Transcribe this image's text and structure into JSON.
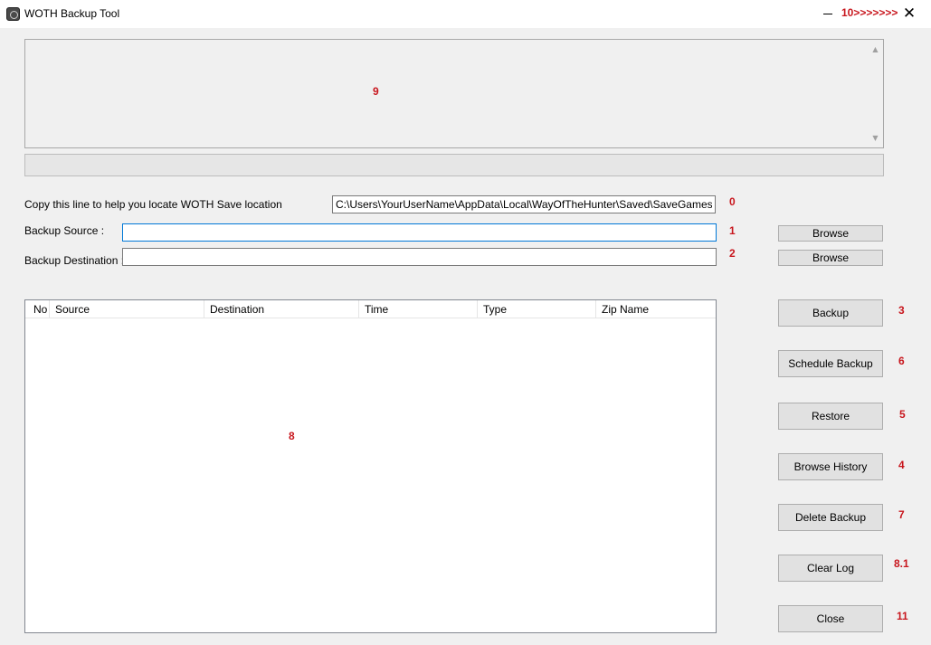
{
  "window": {
    "title": "WOTH Backup Tool",
    "icon": "app-icon",
    "close_glyph": "✕"
  },
  "colors": {
    "callout": "#c8161d",
    "background": "#f0f0f0",
    "focus_border": "#0078d7"
  },
  "callouts": {
    "c0": "0",
    "c1": "1",
    "c2": "2",
    "c3": "3",
    "c4": "4",
    "c5": "5",
    "c6": "6",
    "c7": "7",
    "c8": "8",
    "c8_1": "8.1",
    "c9": "9",
    "c10": "10>>>>>>>",
    "c11": "11"
  },
  "save_location": {
    "label": "Copy this line to help you locate WOTH Save location",
    "value": "C:\\Users\\YourUserName\\AppData\\Local\\WayOfTheHunter\\Saved\\SaveGames"
  },
  "backup_source": {
    "label": "Backup Source :",
    "value": "",
    "browse_label": "Browse"
  },
  "backup_destination": {
    "label": "Backup Destination :",
    "value": "",
    "browse_label": "Browse"
  },
  "history_table": {
    "columns": [
      "No",
      "Source",
      "Destination",
      "Time",
      "Type",
      "Zip Name"
    ],
    "rows": []
  },
  "actions": {
    "backup": "Backup",
    "schedule_backup": "Schedule Backup",
    "restore": "Restore",
    "browse_history": "Browse History",
    "delete_backup": "Delete Backup",
    "clear_log": "Clear Log",
    "close": "Close"
  }
}
